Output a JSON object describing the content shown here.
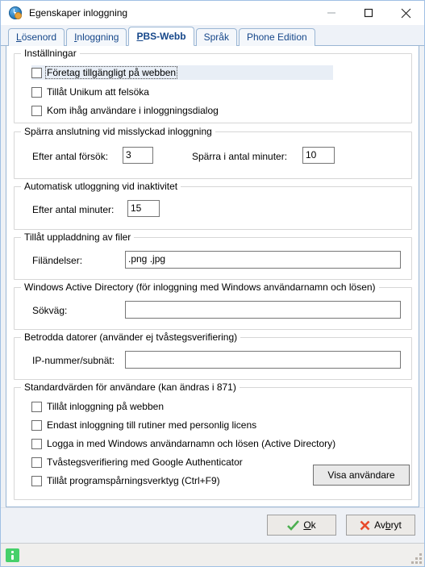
{
  "window": {
    "title": "Egenskaper inloggning",
    "app_icon": "clock-settings-icon",
    "minimize_label": "Minimera",
    "maximize_label": "Maximera",
    "close_label": "Stäng"
  },
  "tabs": [
    {
      "label": "Lösenord",
      "accel": "L",
      "active": false
    },
    {
      "label": "Inloggning",
      "accel": "I",
      "active": false
    },
    {
      "label": "PBS-Webb",
      "accel": "P",
      "active": true
    },
    {
      "label": "Språk",
      "accel": "",
      "active": false
    },
    {
      "label": "Phone Edition",
      "accel": "",
      "active": false
    }
  ],
  "groups": {
    "settings": {
      "title": "Inställningar",
      "checkboxes": [
        {
          "label": "Företag tillgängligt på webben",
          "checked": false,
          "focused": true
        },
        {
          "label": "Tillåt Unikum att felsöka",
          "checked": false,
          "focused": false
        },
        {
          "label": "Kom ihåg användare i inloggningsdialog",
          "checked": false,
          "focused": false
        }
      ]
    },
    "lockout": {
      "title": "Spärra anslutning vid misslyckad inloggning",
      "attempts_label": "Efter antal försök:",
      "attempts_value": "3",
      "minutes_label": "Spärra i antal minuter:",
      "minutes_value": "10"
    },
    "autologout": {
      "title": "Automatisk utloggning vid inaktivitet",
      "minutes_label": "Efter antal minuter:",
      "minutes_value": "15"
    },
    "upload": {
      "title": "Tillåt uppladdning av filer",
      "extensions_label": "Filändelser:",
      "extensions_value": ".png .jpg"
    },
    "activedirectory": {
      "title": "Windows Active Directory (för inloggning med Windows användarnamn och lösen)",
      "path_label": "Sökväg:",
      "path_value": ""
    },
    "trusted": {
      "title": "Betrodda datorer (använder ej tvåstegsverifiering)",
      "ip_label": "IP-nummer/subnät:",
      "ip_value": ""
    },
    "defaults": {
      "title": "Standardvärden för användare (kan ändras i 871)",
      "checkboxes": [
        {
          "label": "Tillåt inloggning på webben",
          "checked": false
        },
        {
          "label": "Endast inloggning till rutiner med personlig licens",
          "checked": false
        },
        {
          "label": "Logga in med Windows användarnamn och lösen (Active Directory)",
          "checked": false
        },
        {
          "label": "Tvåstegsverifiering med Google Authenticator",
          "checked": false
        },
        {
          "label": "Tillåt programspårningsverktyg (Ctrl+F9)",
          "checked": false
        }
      ],
      "show_users_button": "Visa användare"
    }
  },
  "footer": {
    "ok_label": "Ok",
    "ok_accel": "O",
    "ok_icon": "green-check-icon",
    "cancel_label": "Avbryt",
    "cancel_accel": "b",
    "cancel_icon": "red-x-icon"
  },
  "statusbar": {
    "icon": "info-icon",
    "text": ""
  },
  "colors": {
    "accent_border": "#a0c0e4",
    "tab_text": "#16478a",
    "focus_highlight": "#e8eef6",
    "ok_green": "#4caf50",
    "cancel_red": "#e8492b",
    "status_green": "#46d06a"
  }
}
